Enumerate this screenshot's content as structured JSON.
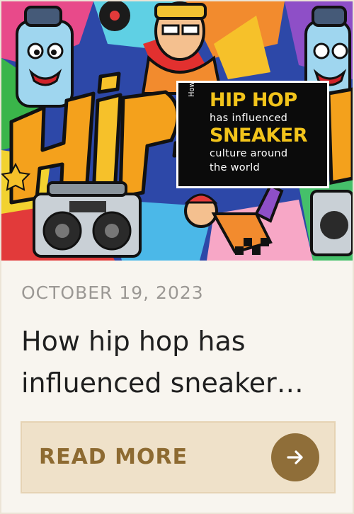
{
  "hero": {
    "title_box": {
      "how": "How",
      "line1": "HIP HOP",
      "line2": "has influenced",
      "line3": "SNEAKER",
      "line4": "culture around",
      "line5": "the world"
    },
    "graffiti_text": "Hip-H"
  },
  "post": {
    "date": "OCTOBER 19, 2023",
    "title_line1": "How hip hop has",
    "title_line2": "influenced sneaker…"
  },
  "cta": {
    "label": "READ MORE",
    "icon": "arrow-right-icon"
  },
  "colors": {
    "background": "#f8f5ef",
    "accent": "#8f6e39",
    "button_bg": "#efe1c9",
    "title_yellow": "#f2c41b"
  }
}
